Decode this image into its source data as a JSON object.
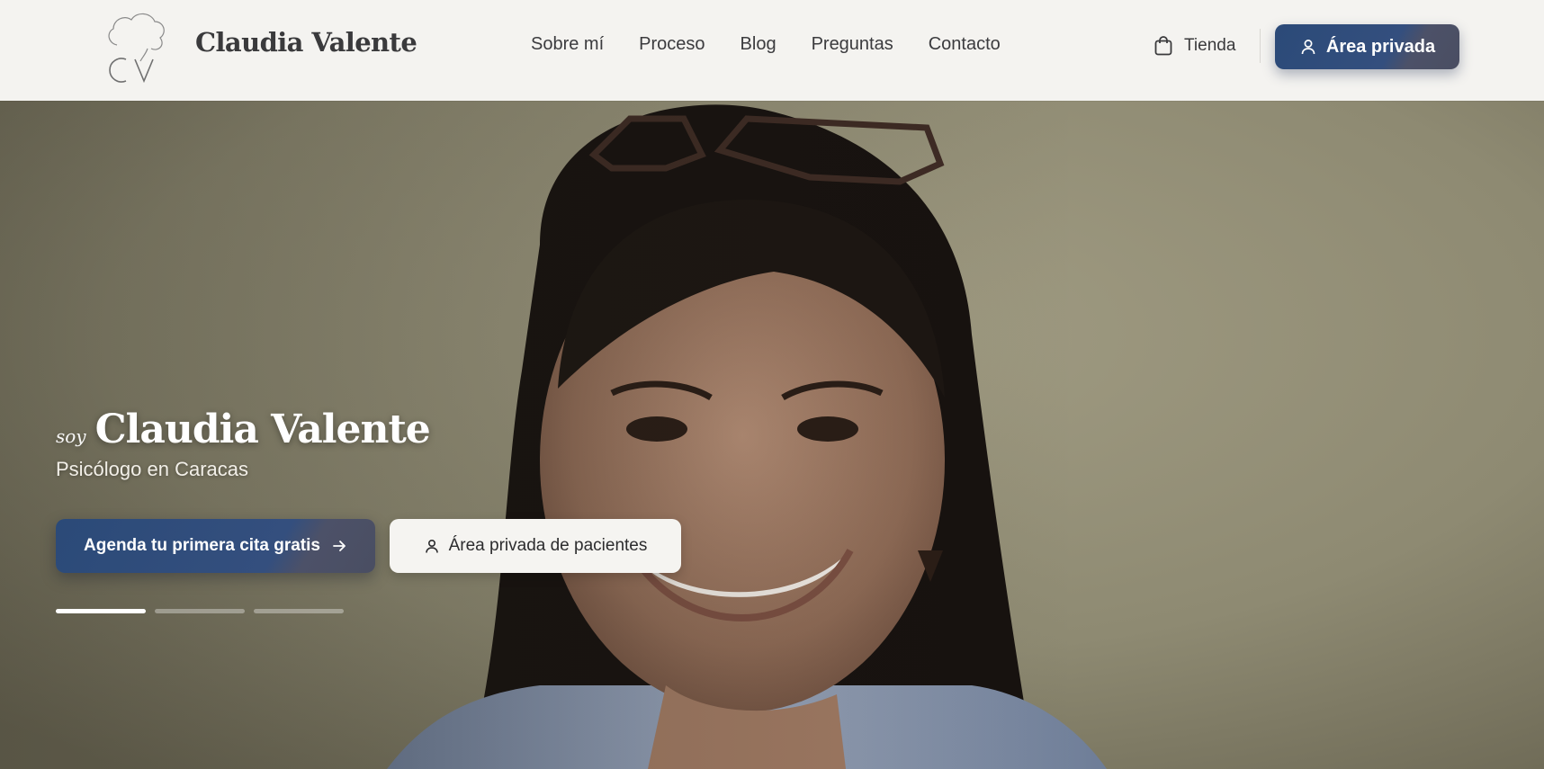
{
  "header": {
    "logo_monogram": "CV",
    "brand_name": "Claudia Valente",
    "nav": [
      {
        "label": "Sobre mí"
      },
      {
        "label": "Proceso"
      },
      {
        "label": "Blog"
      },
      {
        "label": "Preguntas"
      },
      {
        "label": "Contacto"
      }
    ],
    "shop_label": "Tienda",
    "shop_icon": "shopping-bag-icon",
    "private_label": "Área privada",
    "private_icon": "user-icon"
  },
  "hero": {
    "soy": "soy",
    "name": "Claudia Valente",
    "subtitle": "Psicólogo en Caracas",
    "cta_primary": "Agenda tu primera cita gratis",
    "cta_primary_icon": "arrow-right-icon",
    "cta_secondary": "Área privada de pacientes",
    "cta_secondary_icon": "user-icon",
    "slides_total": 3,
    "active_slide": 1
  },
  "colors": {
    "accent": "#2b4a78",
    "header_bg": "#f4f3f0",
    "text_dark": "#3a3a3c"
  }
}
